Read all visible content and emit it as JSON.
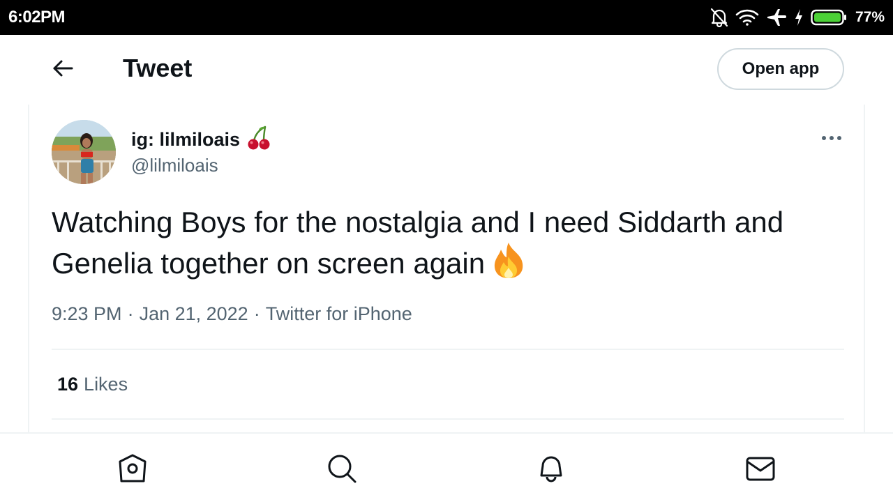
{
  "status_bar": {
    "time": "6:02PM",
    "battery_percent": "77%",
    "icons": [
      "notifications-off-icon",
      "wifi-icon",
      "airplane-icon",
      "charging-icon",
      "battery-icon"
    ],
    "battery_color": "#4cd137"
  },
  "header": {
    "title": "Tweet",
    "back_icon": "arrow-left-icon",
    "open_app_label": "Open app"
  },
  "tweet": {
    "display_name": "ig: lilmiloais",
    "name_emoji": "cherries-icon",
    "handle": "@lilmiloais",
    "text": "Watching Boys for the nostalgia and I need Siddarth and Genelia together on screen again",
    "text_emoji": "fire-icon",
    "time": "9:23 PM",
    "date": "Jan 21, 2022",
    "source": "Twitter for iPhone",
    "separator": "·",
    "likes_count": "16",
    "likes_label": "Likes"
  },
  "bottom_nav": {
    "items": [
      "home-icon",
      "search-icon",
      "notifications-icon",
      "messages-icon"
    ]
  }
}
